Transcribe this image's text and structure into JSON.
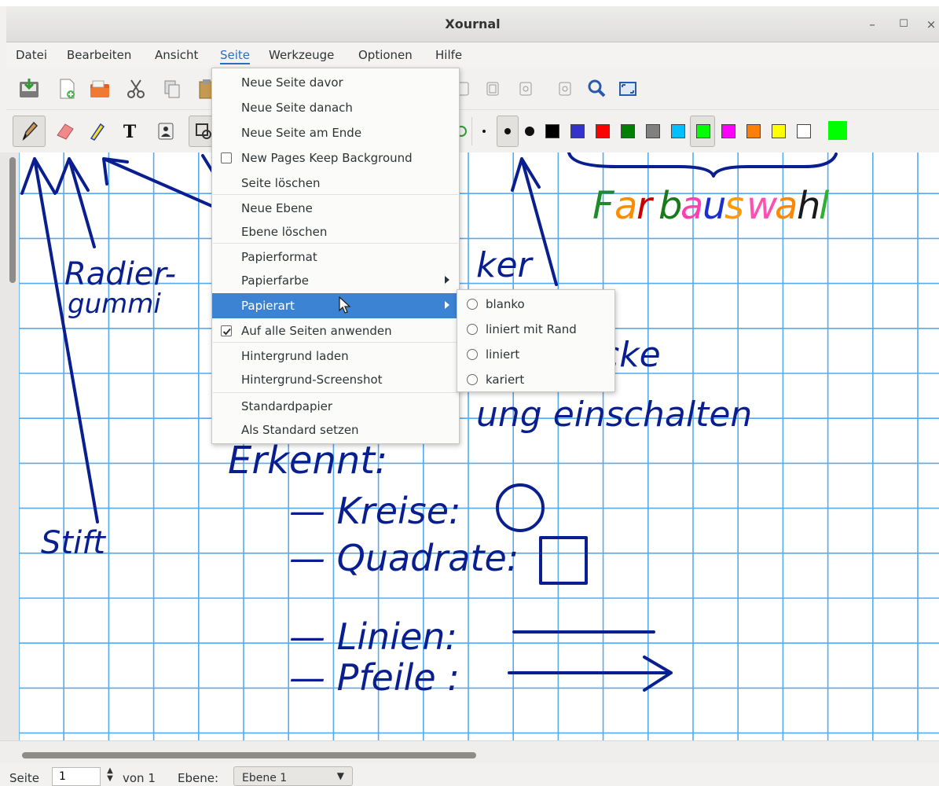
{
  "window": {
    "title": "Xournal",
    "minimize": "–",
    "maximize": "☐",
    "close": "×"
  },
  "menubar": [
    "Datei",
    "Bearbeiten",
    "Ansicht",
    "Seite",
    "Werkzeuge",
    "Optionen",
    "Hilfe"
  ],
  "seite_menu": {
    "items": [
      "Neue Seite davor",
      "Neue Seite danach",
      "Neue Seite am Ende",
      "New Pages Keep Background",
      "Seite löschen",
      "Neue Ebene",
      "Ebene löschen",
      "Papierformat",
      "Papierfarbe",
      "Papierart",
      "Auf alle Seiten anwenden",
      "Hintergrund laden",
      "Hintergrund-Screenshot",
      "Standardpapier",
      "Als Standard setzen"
    ],
    "highlighted": "Papierart"
  },
  "papierart_submenu": [
    "blanko",
    "liniert mit Rand",
    "liniert",
    "kariert"
  ],
  "palette": [
    "#000000",
    "#3333cc",
    "#ff0000",
    "#008000",
    "#808080",
    "#00c0ff",
    "#00ff00",
    "#ff00ff",
    "#ff8000",
    "#ffff00",
    "#ffffff",
    "#00ff00"
  ],
  "statusbar": {
    "page_label": "Seite",
    "page_value": "1",
    "of_label": "von 1",
    "layer_label": "Ebene:",
    "layer_value": "Ebene 1"
  },
  "canvas": {
    "ink_color": "#0a1f8f",
    "notes": [
      "Radier-",
      "gummi",
      "Stift",
      "ker",
      "cke",
      "ung einschalten",
      "Erkennt:",
      "— Kreise:",
      "— Quadrate:",
      "— Linien:",
      "— Pfeile :"
    ],
    "palette_heading": [
      "F",
      "a",
      "r",
      "b",
      "a",
      "u",
      "s",
      "w",
      "a",
      "h",
      "l"
    ],
    "palette_heading_colors": [
      "#1e8a2a",
      "#ff8c00",
      "#c80000",
      "#1a7a1a",
      "#ff3fb0",
      "#1a2fd0",
      "#ff9a00",
      "#ff4fb0",
      "#ff8800",
      "#1a1a1a",
      "#30b030"
    ]
  }
}
